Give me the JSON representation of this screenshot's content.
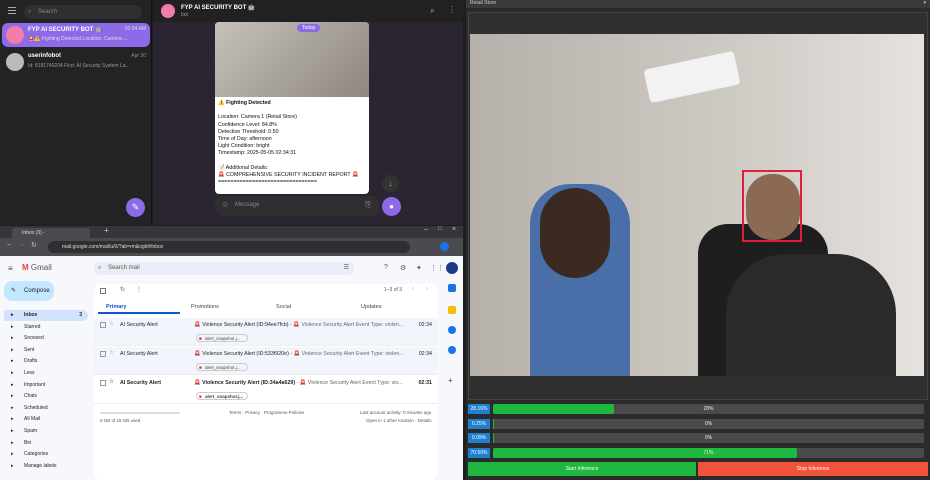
{
  "telegram": {
    "search_placeholder": "Search",
    "chats": [
      {
        "name": "FYP AI SECURITY BOT 🤖",
        "preview": "🚨⚠️ Fighting Detected Location: Camera ...",
        "time": "02:34 AM"
      },
      {
        "name": "userinfobot",
        "preview": "Id: 8191740204 First: AI Security System La...",
        "time": "Apr 30"
      }
    ],
    "header_title": "FYP AI SECURITY BOT 🤖",
    "header_subtitle": "bot",
    "date_badge": "Today",
    "message_lines": [
      "⚠️ Fighting Detected",
      "",
      "Location: Camera 1 (Retail Store)",
      "Confidence Level: 84.8%",
      "Detection Threshold: 0.50",
      "Time of Day: afternoon",
      "Light Condition: bright",
      "Timestamp: 2025-05-05 02:34:31",
      "",
      "📝 Additional Details:",
      "🚨 COMPREHENSIVE SECURITY INCIDENT REPORT 🚨",
      "================================"
    ],
    "composer_placeholder": "Message"
  },
  "gmail": {
    "tab_title": "Inbox (3) - ai.fyp.082729@gm...",
    "url": "mail.google.com/mail/u/0/?ab=rm&ogbl#inbox",
    "logo": "Gmail",
    "search_placeholder": "Search mail",
    "compose": "Compose",
    "nav": [
      {
        "label": "Inbox",
        "count": "3"
      },
      {
        "label": "Starred",
        "count": ""
      },
      {
        "label": "Snoozed",
        "count": ""
      },
      {
        "label": "Sent",
        "count": ""
      },
      {
        "label": "Drafts",
        "count": ""
      },
      {
        "label": "Less",
        "count": ""
      },
      {
        "label": "Important",
        "count": ""
      },
      {
        "label": "Chats",
        "count": ""
      },
      {
        "label": "Scheduled",
        "count": ""
      },
      {
        "label": "All Mail",
        "count": ""
      },
      {
        "label": "Spam",
        "count": ""
      },
      {
        "label": "Bin",
        "count": ""
      },
      {
        "label": "Categories",
        "count": ""
      },
      {
        "label": "Manage labels",
        "count": ""
      }
    ],
    "page_count": "1–3 of 3",
    "tabs": [
      "Primary",
      "Promotions",
      "Social",
      "Updates"
    ],
    "emails": [
      {
        "sender": "AI Security Alert",
        "subject": "🚨 Violence Security Alert (ID:94ee7fcb)",
        "snippet": "- 🚨 Violence Security Alert Event Type: violen...",
        "attachment": "alert_snapshot.j...",
        "time": "02:34"
      },
      {
        "sender": "AI Security Alert",
        "subject": "🚨 Violence Security Alert (ID:533f920e)",
        "snippet": "- 🚨 Violence Security Alert Event Type: violen...",
        "attachment": "alert_snapshot.j...",
        "time": "02:34"
      },
      {
        "sender": "AI Security Alert",
        "subject": "🚨 Violence Security Alert (ID:34a4a629)",
        "snippet": "- 🚨 Violence Security Alert Event Type: vio...",
        "attachment": "alert_snapshot.j...",
        "time": "02:31"
      }
    ],
    "storage": "0 GB of 15 GB used",
    "footer_links": "Terms · Privacy · Programme Policies",
    "activity": "Last account activity: 0 minutes ago",
    "activity2": "Open in 1 other location · Details"
  },
  "inference": {
    "window_title": "Retail Store",
    "bars": [
      {
        "label": "28.16%",
        "value": 0.28,
        "text": "28%"
      },
      {
        "label": "0.25%",
        "value": 0.0025,
        "text": "0%"
      },
      {
        "label": "0.09%",
        "value": 0.0009,
        "text": "0%"
      },
      {
        "label": "70.50%",
        "value": 0.705,
        "text": "71%"
      }
    ],
    "start_label": "Start Inference",
    "stop_label": "Stop Inference",
    "colors": {
      "accent": "#1fb83f",
      "stop": "#f0533a",
      "badge": "#1f7fd1"
    }
  }
}
